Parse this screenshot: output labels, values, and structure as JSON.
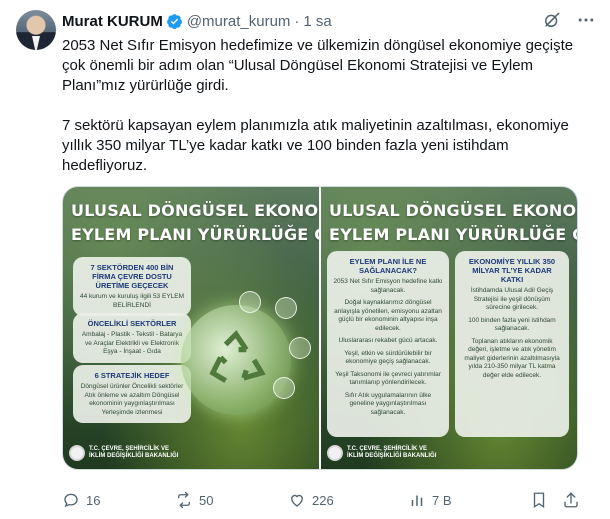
{
  "author": {
    "name": "Murat KURUM",
    "handle": "@murat_kurum",
    "separator": "·",
    "time": "1 sa"
  },
  "tweet_text": {
    "p1": "2053 Net Sıfır Emisyon hedefimize ve ülkemizin döngüsel ekonomiye geçişte çok önemli bir adım olan “Ulusal Döngüsel Ekonomi Stratejisi ve Eylem Planı”mız yürürlüğe girdi.",
    "p2": "7 sektörü kapsayan eylem planımızla atık maliyetinin azaltılması, ekonomiye yıllık 350 milyar TL’ye kadar katkı ve 100 binden fazla yeni istihdam hedefliyoruz."
  },
  "media": {
    "left": {
      "heading_line1": "ULUSAL DÖNGÜSEL EKONOMİ STRATEJİSİ VE",
      "heading_line2": "EYLEM PLANI YÜRÜRLÜĞE GİRDİ",
      "card1": {
        "title": "7 SEKTÖRDEN 400 BİN FİRMA ÇEVRE DOSTU ÜRETİME GEÇECEK",
        "body": "44 kurum ve kuruluş ilgili 53 EYLEM BELİRLENDİ"
      },
      "card2": {
        "title": "ÖNCELİKLİ SEKTÖRLER",
        "body": "Ambalaj - Plastik - Tekstil - Batarya ve Araçlar Elektrikli ve Elektronik Eşya - İnşaat - Gıda"
      },
      "card3": {
        "title": "6 STRATEJİK HEDEF",
        "body": "Döngüsel ürünler Öncelikli sektörler Atık önleme ve azaltım Döngüsel ekonominin yaygınlaştırılması Yerleşimde izlenmesi"
      },
      "ministry": "T.C. ÇEVRE, ŞEHİRCİLİK VE İKLİM DEĞİŞİKLİĞİ BAKANLIĞI"
    },
    "right": {
      "heading_line1": "ULUSAL DÖNGÜSEL EKONOMİ STRATEJİSİ VE",
      "heading_line2": "EYLEM PLANI YÜRÜRLÜĞE GİRDİ",
      "card_left": {
        "title": "EYLEM PLANI İLE NE SAĞLANACAK?",
        "items": [
          "2053 Net Sıfır Emisyon hedefine katkı sağlanacak.",
          "Doğal kaynaklarımız döngüsel anlayışla yönetilen, emisyonu azaltan güçlü bir ekonominin altyapısı inşa edilecek.",
          "Uluslararası rekabet gücü artacak.",
          "Yeşil, etkin ve sürdürülebilir bir ekonomiye geçiş sağlanacak.",
          "Yeşil Taksonomi ile çevreci yatırımlar tanımlanıp yönlendirilecek.",
          "Sıfır Atık uygulamalarının ülke geneline yaygınlaştırılması sağlanacak."
        ]
      },
      "card_right": {
        "title": "EKONOMİYE YILLIK 350 MİLYAR TL’YE KADAR KATKI",
        "items": [
          "İstihdamda Ulusal Adil Geçiş Stratejisi ile yeşil dönüşüm sürecine girilecek.",
          "100 binden fazla yeni istihdam sağlanacak.",
          "Toplanan atıkların ekonomik değeri, işletme ve atık yönetim maliyet giderlerinin azaltılmasıyla yılda 210-350 milyar TL katma değer elde edilecek."
        ]
      },
      "ministry": "T.C. ÇEVRE, ŞEHİRCİLİK VE İKLİM DEĞİŞİKLİĞİ BAKANLIĞI"
    }
  },
  "actions": {
    "replies": "16",
    "reposts": "50",
    "likes": "226",
    "views": "7 B"
  },
  "icons": {
    "verified": "verified-badge-icon",
    "grok": "grok-icon",
    "more": "more-icon",
    "reply": "reply-icon",
    "repost": "repost-icon",
    "like": "heart-icon",
    "views": "views-icon",
    "bookmark": "bookmark-icon",
    "share": "share-icon"
  },
  "colors": {
    "accent_blue": "#1d9bf0",
    "text_primary": "#0f1419",
    "text_secondary": "#536471",
    "card_title_blue": "#1e3a7a",
    "card_highlight_red": "#a02626"
  }
}
